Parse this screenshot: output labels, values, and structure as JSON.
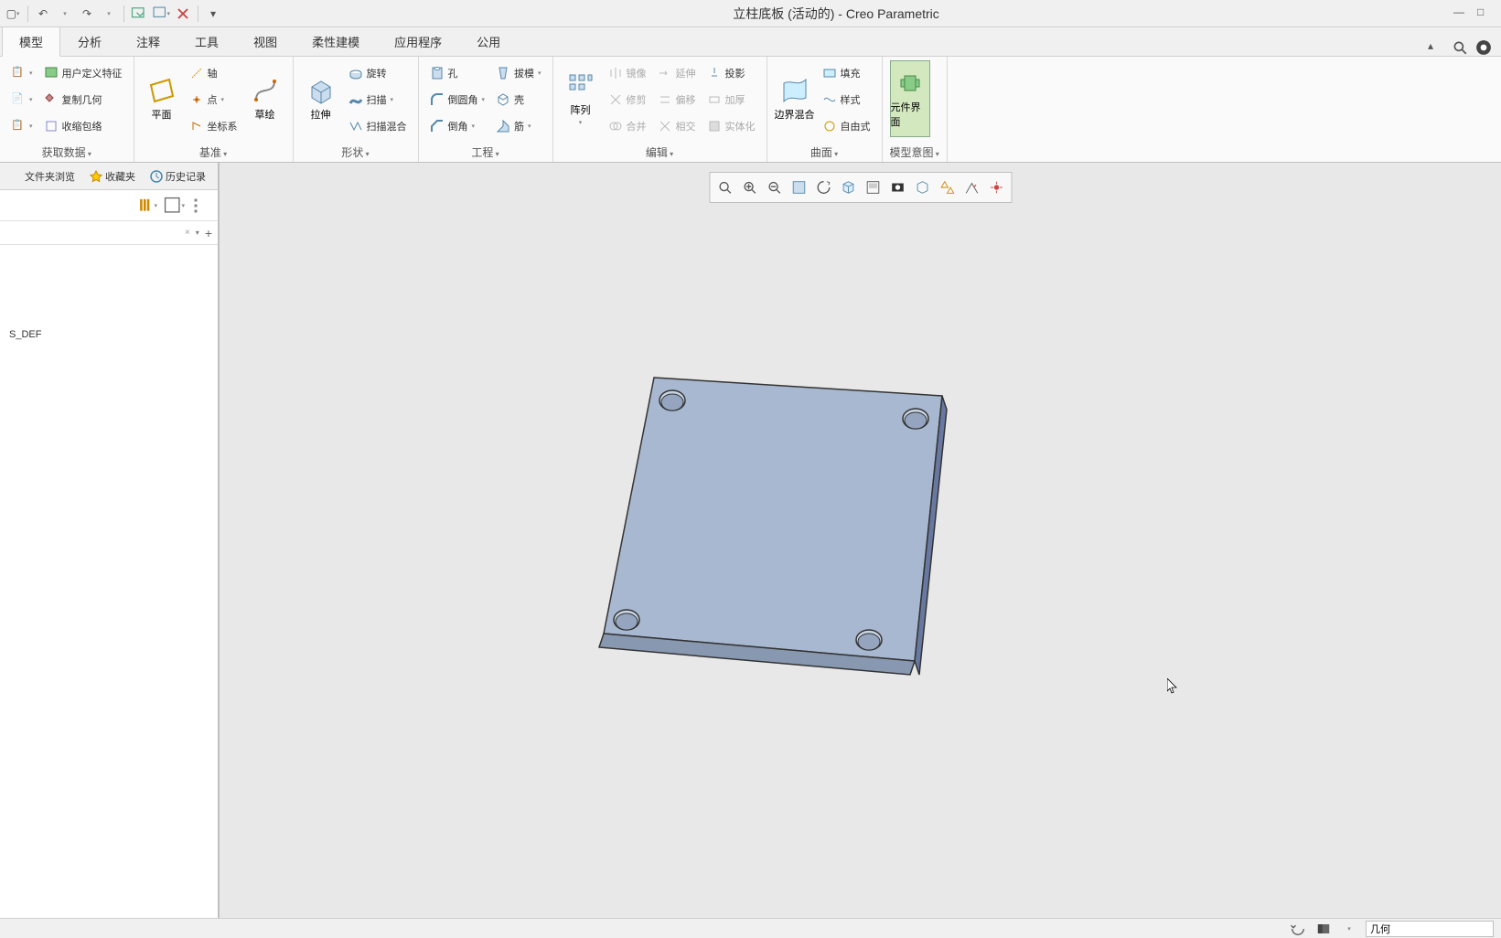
{
  "window": {
    "title": "立柱底板 (活动的) - Creo Parametric"
  },
  "ribbon": {
    "tabs": [
      "模型",
      "分析",
      "注释",
      "工具",
      "视图",
      "柔性建模",
      "应用程序",
      "公用"
    ],
    "activeTab": 0,
    "groups": {
      "getData": {
        "label": "获取数据",
        "items": [
          "用户定义特征",
          "复制几何",
          "收缩包络"
        ]
      },
      "datum": {
        "label": "基准",
        "plane": "平面",
        "sketch": "草绘",
        "axis": "轴",
        "point": "点",
        "csys": "坐标系"
      },
      "shape": {
        "label": "形状",
        "extrude": "拉伸",
        "revolve": "旋转",
        "sweep": "扫描",
        "sweepBlend": "扫描混合"
      },
      "engineering": {
        "label": "工程",
        "hole": "孔",
        "round": "倒圆角",
        "chamfer": "倒角",
        "draft": "拔模",
        "shell": "壳",
        "rib": "筋"
      },
      "edit": {
        "label": "编辑",
        "pattern": "阵列",
        "mirror": "镜像",
        "trim": "修剪",
        "merge": "合并",
        "extend": "延伸",
        "offset": "偏移",
        "intersect": "相交",
        "project": "投影",
        "thicken": "加厚",
        "solidify": "实体化"
      },
      "surface": {
        "label": "曲面",
        "boundary": "边界混合",
        "fill": "填充",
        "style": "样式",
        "freestyle": "自由式"
      },
      "intent": {
        "label": "模型意图",
        "componentUI": "元件界面"
      }
    }
  },
  "navigator": {
    "tabs": [
      "文件夹浏览",
      "收藏夹",
      "历史记录"
    ],
    "treeItem": "S_DEF"
  },
  "status": {
    "filterLabel": "几何"
  }
}
